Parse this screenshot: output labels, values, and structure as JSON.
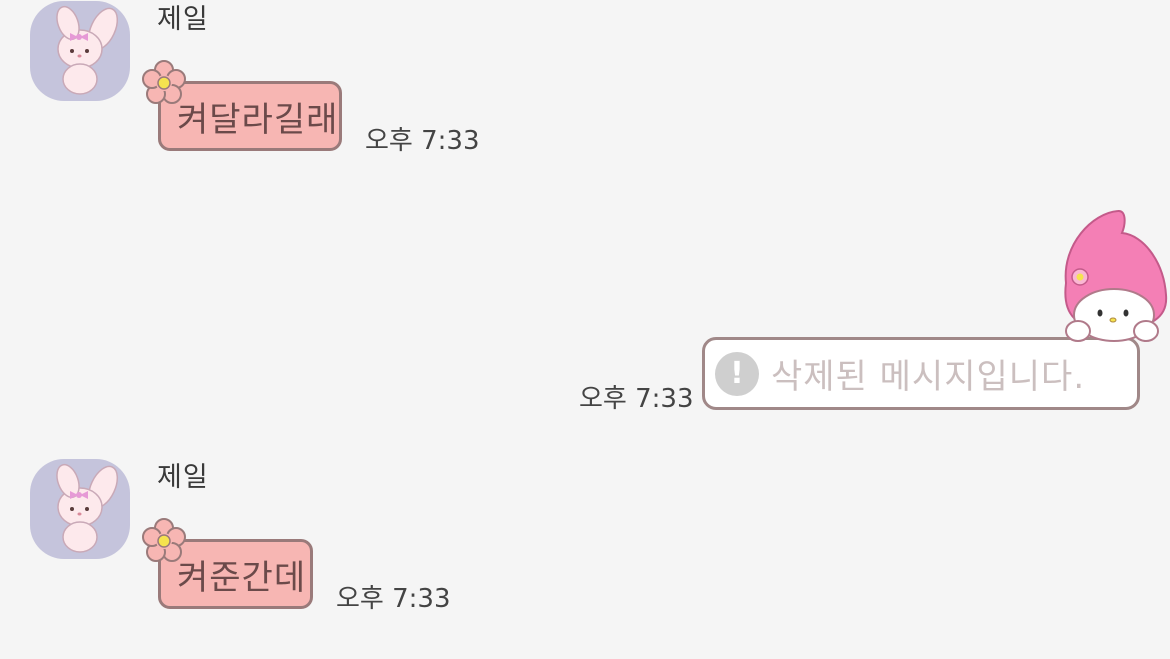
{
  "messages": [
    {
      "direction": "incoming",
      "sender": "제일",
      "text": "켜달라길래",
      "time": "오후 7:33"
    },
    {
      "direction": "outgoing",
      "deleted": true,
      "text": "삭제된 메시지입니다.",
      "time": "오후 7:33"
    },
    {
      "direction": "incoming",
      "sender": "제일",
      "text": "켜준간데",
      "time": "오후 7:33"
    }
  ],
  "theme": {
    "background": "#f5f5f5",
    "incoming_bubble": "#f7b6b3",
    "outgoing_bubble": "#ffffff",
    "avatar_bg": "#c5c4dc"
  },
  "icons": {
    "avatar": "bunny-character-avatar",
    "bubble_decoration": "flower-icon",
    "deleted_notice": "exclamation-icon",
    "outgoing_decoration": "my-melody-character"
  }
}
